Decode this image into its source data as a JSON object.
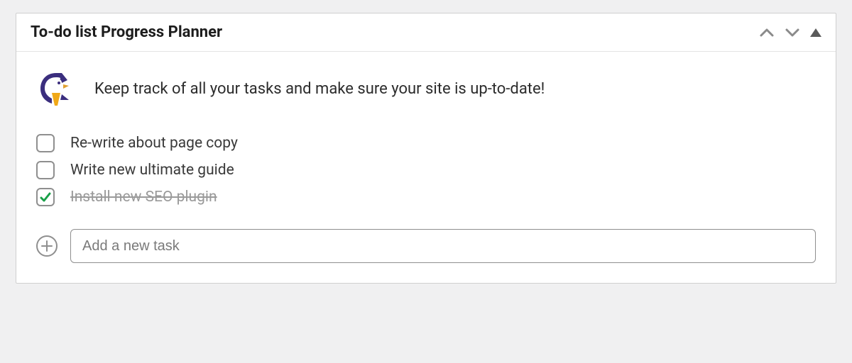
{
  "header": {
    "title": "To-do list Progress Planner"
  },
  "intro": {
    "text": "Keep track of all your tasks and make sure your site is up-to-date!"
  },
  "tasks": [
    {
      "label": "Re-write about page copy",
      "done": false
    },
    {
      "label": "Write new ultimate guide",
      "done": false
    },
    {
      "label": "Install new SEO plugin",
      "done": true
    }
  ],
  "add": {
    "placeholder": "Add a new task"
  },
  "icons": {
    "move_up": "chevron-up",
    "move_down": "chevron-down",
    "collapse": "triangle-up",
    "add": "plus",
    "check": "checkmark"
  }
}
